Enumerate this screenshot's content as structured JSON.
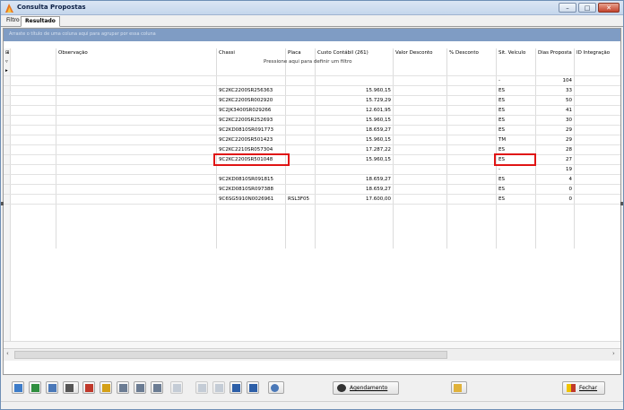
{
  "window": {
    "title": "Consulta Propostas",
    "controls": {
      "minimize": "–",
      "maximize": "□",
      "close": "✕"
    }
  },
  "tabs": [
    {
      "label": "Filtro",
      "active": false
    },
    {
      "label": "Resultado",
      "active": true
    }
  ],
  "groupbar": {
    "text": "Arraste o título de uma coluna aqui para agrupar por essa coluna"
  },
  "grid": {
    "columns": {
      "observacao": "Observação",
      "chassi": "Chassi",
      "placa": "Placa",
      "custo": "Custo Contábil (261)",
      "valor_desconto": "Valor Desconto",
      "perc_desconto": "% Desconto",
      "sit_veiculo": "Sit. Veículo",
      "dias_proposta": "Dias Proposta",
      "id_integracao": "ID Integração"
    },
    "filter_hint": "Pressione aqui para definir um filtro",
    "rows": [
      {
        "chassi": "",
        "placa": "",
        "custo": "",
        "sit": "",
        "dias": ""
      },
      {
        "chassi": "",
        "placa": "",
        "custo": "",
        "sit": "-",
        "dias": "104"
      },
      {
        "chassi": "9C2KC2200SR256363",
        "placa": "",
        "custo": "15.960,15",
        "sit": "ES",
        "dias": "33"
      },
      {
        "chassi": "9C2KC2200SR002920",
        "placa": "",
        "custo": "15.729,29",
        "sit": "ES",
        "dias": "50"
      },
      {
        "chassi": "9C2JK3400SR029266",
        "placa": "",
        "custo": "12.601,95",
        "sit": "ES",
        "dias": "41"
      },
      {
        "chassi": "9C2KC2200SR252693",
        "placa": "",
        "custo": "15.960,15",
        "sit": "ES",
        "dias": "30"
      },
      {
        "chassi": "9C2KD0810SR091773",
        "placa": "",
        "custo": "18.659,27",
        "sit": "ES",
        "dias": "29"
      },
      {
        "chassi": "9C2KC2200SR501423",
        "placa": "",
        "custo": "15.960,15",
        "sit": "TM",
        "dias": "29"
      },
      {
        "chassi": "9C2KC2210SR057304",
        "placa": "",
        "custo": "17.287,22",
        "sit": "ES",
        "dias": "28"
      },
      {
        "chassi": "9C2KC2200SR501048",
        "placa": "",
        "custo": "15.960,15",
        "sit": "ES",
        "dias": "27"
      },
      {
        "chassi": "",
        "placa": "",
        "custo": "",
        "sit": "-",
        "dias": "19"
      },
      {
        "chassi": "9C2KD0810SR091815",
        "placa": "",
        "custo": "18.659,27",
        "sit": "ES",
        "dias": "4"
      },
      {
        "chassi": "9C2KD0810SR097388",
        "placa": "",
        "custo": "18.659,27",
        "sit": "ES",
        "dias": "0"
      },
      {
        "chassi": "9C6SG5910N0026961",
        "placa": "RSL3F05",
        "custo": "17.600,00",
        "sit": "ES",
        "dias": "0"
      }
    ]
  },
  "toolbar": {
    "agendamento_label": "Agendamento",
    "fechar_label": "Fechar"
  },
  "colors": {
    "highlight": "#e01515",
    "groupbar": "#7f9cc4",
    "titlebar": "#c5d6ec"
  }
}
